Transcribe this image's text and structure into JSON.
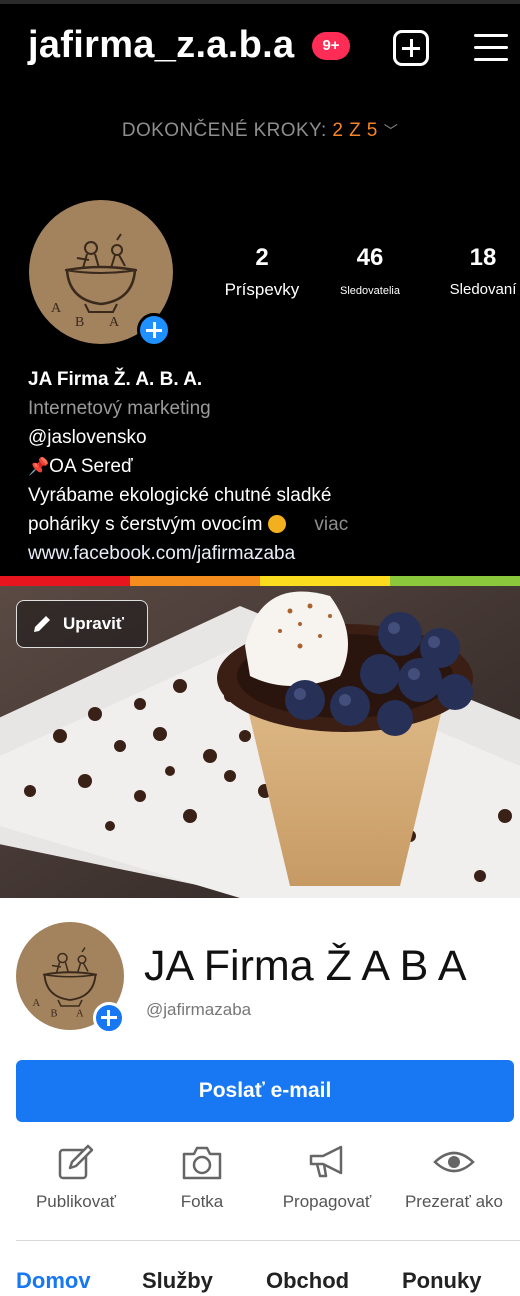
{
  "instagram": {
    "username": "jafirma_z.a.b.a",
    "notification_badge": "9+",
    "steps": {
      "label": "DOKONČENÉ KROKY: ",
      "progress": "2 Z 5"
    },
    "stats": [
      {
        "value": "2",
        "label": "Príspevky"
      },
      {
        "value": "46",
        "label": "Sledovatelia"
      },
      {
        "value": "18",
        "label": "Sledovaní"
      }
    ],
    "bio": {
      "name": "JA Firma Ž. A. B. A.",
      "category": "Internetový marketing",
      "mention": "@jaslovensko",
      "location": "OA Sereď",
      "description_line1": "Vyrábame ekologické chutné sladké",
      "description_line2": "poháriky s čerstvým ovocím",
      "more": "viac",
      "link": "www.facebook.com/jafirmazaba"
    },
    "colors": {
      "badge": "#ff2d55",
      "progress": "#f58529",
      "add": "#1e90ff"
    }
  },
  "facebook": {
    "edit_cover_label": "Upraviť",
    "page_name": "JA Firma Ž A B A",
    "handle": "@jafirmazaba",
    "email_button": "Poslať e-mail",
    "actions": [
      {
        "label": "Publikovať",
        "icon": "edit-icon"
      },
      {
        "label": "Fotka",
        "icon": "camera-icon"
      },
      {
        "label": "Propagovať",
        "icon": "megaphone-icon"
      },
      {
        "label": "Prezerať ako",
        "icon": "eye-icon"
      }
    ],
    "tabs": [
      "Domov",
      "Služby",
      "Obchod",
      "Ponuky"
    ],
    "active_tab": "Domov",
    "colors": {
      "primary": "#1877f2"
    }
  },
  "rainbow_colors": [
    "#e8141e",
    "#f58c1e",
    "#fbdc1e",
    "#8cc83c"
  ]
}
